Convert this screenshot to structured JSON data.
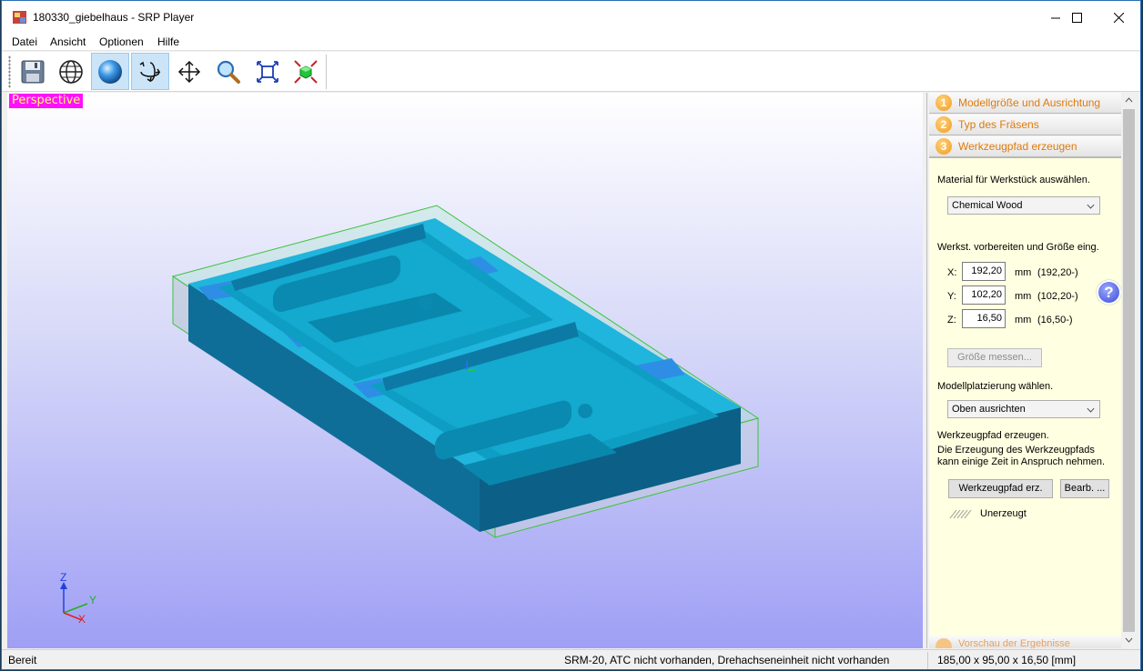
{
  "window": {
    "title": "180330_giebelhaus - SRP Player"
  },
  "menu": {
    "items": [
      "Datei",
      "Ansicht",
      "Optionen",
      "Hilfe"
    ]
  },
  "toolbar": {
    "buttons": [
      "save-icon",
      "globe-icon",
      "sphere-render-icon",
      "rotate-view-icon",
      "pan-icon",
      "zoom-icon",
      "fit-view-icon",
      "center-model-icon"
    ]
  },
  "viewport": {
    "label": "Perspective",
    "axes": {
      "z": "Z",
      "y": "Y",
      "x": "X"
    }
  },
  "panel": {
    "steps": [
      {
        "num": "1",
        "label": "Modellgröße und Ausrichtung"
      },
      {
        "num": "2",
        "label": "Typ des Fräsens"
      },
      {
        "num": "3",
        "label": "Werkzeugpfad erzeugen"
      }
    ],
    "material_label": "Material für Werkstück auswählen.",
    "material_value": "Chemical Wood",
    "size_label": "Werkst. vorbereiten und Größe eing.",
    "x_label": "X:",
    "x_value": "192,20",
    "x_unit": "mm",
    "x_orig": "(192,20-)",
    "y_label": "Y:",
    "y_value": "102,20",
    "y_unit": "mm",
    "y_orig": "(102,20-)",
    "z_label": "Z:",
    "z_value": "16,50",
    "z_unit": "mm",
    "z_orig": "(16,50-)",
    "measure_button": "Größe messen...",
    "placement_label": "Modellplatzierung wählen.",
    "placement_value": "Oben ausrichten",
    "toolpath_label": "Werkzeugpfad erzeugen.",
    "toolpath_note_1": "Die Erzeugung des Werkzeugpfads",
    "toolpath_note_2": "kann einige Zeit in Anspruch nehmen.",
    "create_button": "Werkzeugpfad erz.",
    "edit_button": "Bearb. ...",
    "status_text": "Unerzeugt",
    "help": "?",
    "next_step": "Vorschau der Ergebnisse"
  },
  "statusbar": {
    "left": "Bereit",
    "center": "SRM-20, ATC nicht vorhanden, Drehachseneinheit nicht vorhanden",
    "right": "185,00 x  95,00 x  16,50 [mm]"
  }
}
